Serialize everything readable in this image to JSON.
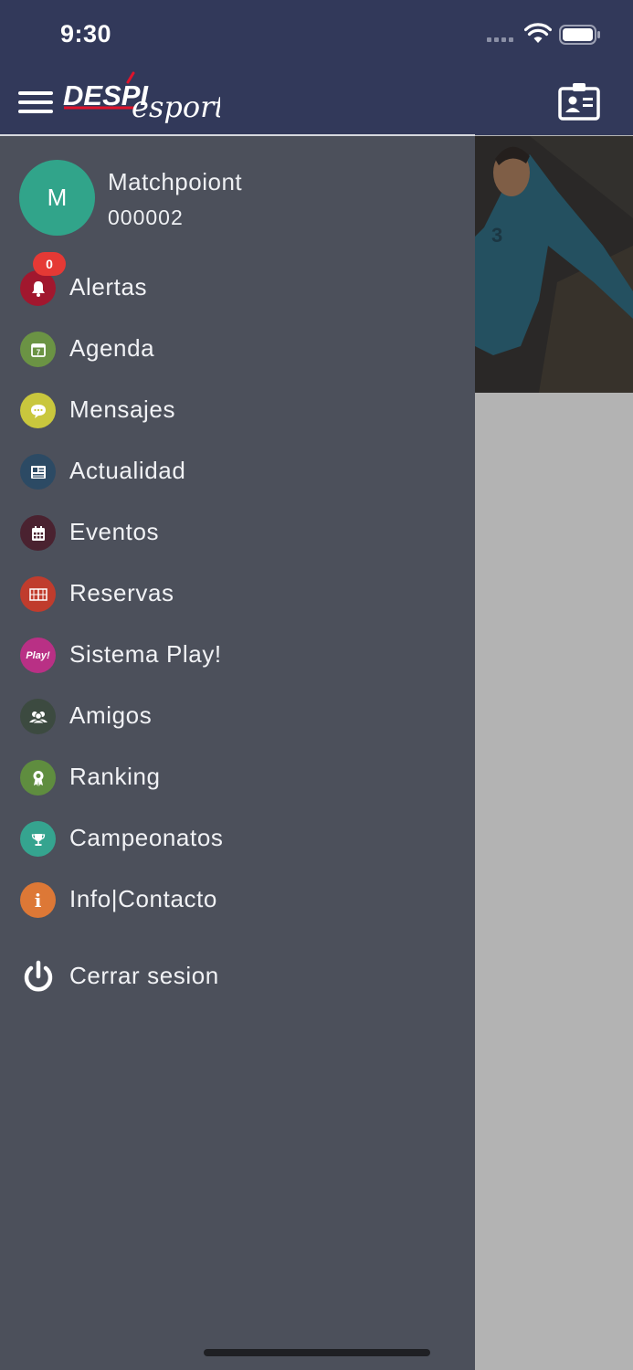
{
  "status_bar": {
    "time": "9:30"
  },
  "app": {
    "logo_text": "DESPI",
    "logo_script": "esport",
    "brand_color": "#32395a",
    "accent_red": "#e0132b"
  },
  "profile": {
    "initial": "M",
    "name": "Matchpoiont",
    "id": "000002",
    "avatar_color": "#31a48a"
  },
  "menu": [
    {
      "key": "alertas",
      "label": "Alertas",
      "icon": "bell-icon",
      "color": "#a1172e",
      "badge": "0"
    },
    {
      "key": "agenda",
      "label": "Agenda",
      "icon": "calendar-icon",
      "color": "#6b9344"
    },
    {
      "key": "mensajes",
      "label": "Mensajes",
      "icon": "chat-bubble-icon",
      "color": "#c9c73d"
    },
    {
      "key": "actualidad",
      "label": "Actualidad",
      "icon": "newspaper-icon",
      "color": "#2c4a64"
    },
    {
      "key": "eventos",
      "label": "Eventos",
      "icon": "events-calendar-icon",
      "color": "#4a2230"
    },
    {
      "key": "reservas",
      "label": "Reservas",
      "icon": "court-icon",
      "color": "#c03c2d"
    },
    {
      "key": "sistema-play",
      "label": "Sistema Play!",
      "icon": "play-icon",
      "icon_text": "Play!",
      "color": "#b93085"
    },
    {
      "key": "amigos",
      "label": "Amigos",
      "icon": "friends-icon",
      "color": "#3c4a40"
    },
    {
      "key": "ranking",
      "label": "Ranking",
      "icon": "ranking-medal-icon",
      "color": "#5f8d3f"
    },
    {
      "key": "campeonatos",
      "label": "Campeonatos",
      "icon": "trophy-icon",
      "color": "#35a48f"
    },
    {
      "key": "info-contacto",
      "label": "Info|Contacto",
      "icon": "info-icon",
      "icon_text": "i",
      "color": "#dd7836"
    }
  ],
  "logout": {
    "label": "Cerrar sesion",
    "icon": "power-icon"
  }
}
